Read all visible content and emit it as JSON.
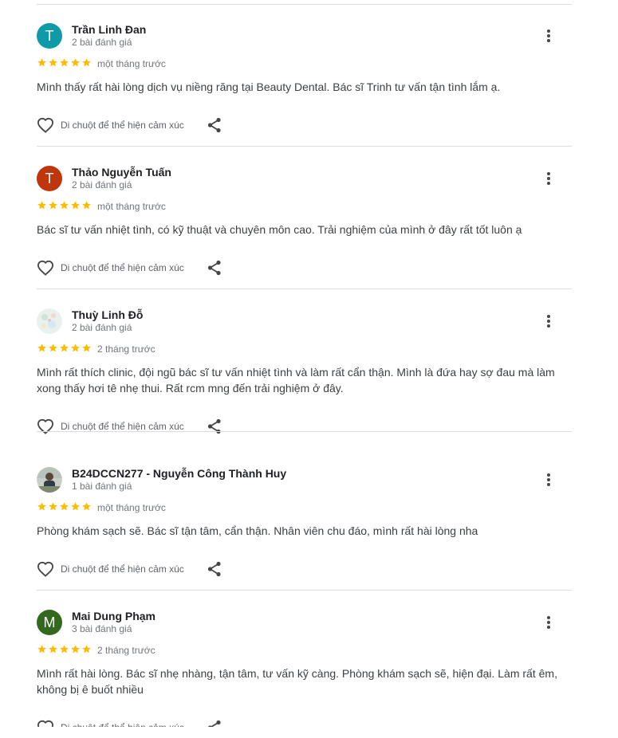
{
  "like_label": "Di chuột để thể hiện cảm xúc",
  "colors": {
    "star": "#fbbc04",
    "divider": "#dadce0"
  },
  "icons": {
    "more": "more-vert-icon",
    "like": "heart-outline-icon",
    "share": "share-icon",
    "star": "star-icon"
  },
  "reviews": [
    {
      "name": "Trần Linh Đan",
      "count": "2 bài đánh giá",
      "initial": "T",
      "avatar_color": "#0f9aa8",
      "rating": 5,
      "time": "một tháng trước",
      "text": "Mình thấy rất hài lòng dịch vụ niềng răng tại Beauty Dental. Bác sĩ Trinh tư vấn tận tình lắm ạ."
    },
    {
      "name": "Thảo Nguyễn Tuấn",
      "count": "2 bài đánh giá",
      "initial": "T",
      "avatar_color": "#c0360c",
      "rating": 5,
      "time": "một tháng trước",
      "text": "Bác sĩ tư vấn nhiệt tình, có kỹ thuật và chuyên môn cao. Trải nghiệm của mình ở đây rất tốt luôn ạ"
    },
    {
      "name": "Thuỳ Linh Đỗ",
      "count": "2 bài đánh giá",
      "initial": "",
      "avatar_color": "#e8f1ee",
      "rating": 5,
      "time": "2 tháng trước",
      "text": "Mình rất thích clinic, đội ngũ bác sĩ tư vấn nhiệt tình và làm rất cẩn thận. Mình là đứa hay sợ đau mà làm xong thấy hơi tê nhẹ thui. Rất rcm mng đến trải nghiệm ở đây."
    },
    {
      "name": "B24DCCN277 - Nguyễn Công Thành Huy",
      "count": "1 bài đánh giá",
      "initial": "",
      "avatar_color": "#9aa8a0",
      "rating": 5,
      "time": "một tháng trước",
      "text": "Phòng khám sạch sẽ. Bác sĩ tận tâm, cẩn thận. Nhân viên chu đáo, mình rất hài lòng nha"
    },
    {
      "name": "Mai Dung Phạm",
      "count": "3 bài đánh giá",
      "initial": "M",
      "avatar_color": "#33691e",
      "rating": 5,
      "time": "2 tháng trước",
      "text": "Mình rất hài lòng. Bác sĩ nhẹ nhàng, tận tâm, tư vấn kỹ càng. Phòng khám sạch sẽ, hiện đại. Làm rất êm, không bị ê buốt nhiều"
    }
  ]
}
